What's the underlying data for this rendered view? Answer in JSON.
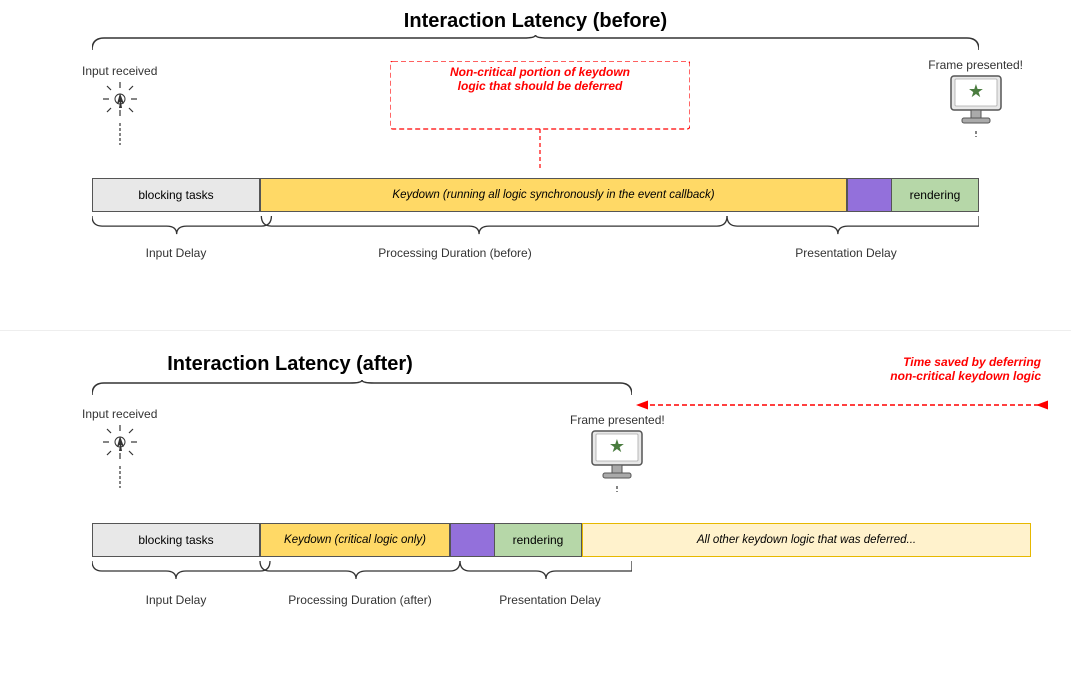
{
  "top": {
    "title": "Interaction Latency (before)",
    "input_received": "Input received",
    "frame_presented": "Frame presented!",
    "red_annotation_line1": "Non-critical portion of keydown",
    "red_annotation_line2": "logic that should be deferred",
    "blocking_tasks": "blocking tasks",
    "keydown_label": "Keydown (running all logic synchronously in the event callback)",
    "rendering": "rendering",
    "input_delay_label": "Input Delay",
    "processing_duration_label": "Processing Duration (before)",
    "presentation_delay_label": "Presentation Delay"
  },
  "bottom": {
    "title": "Interaction Latency (after)",
    "input_received": "Input received",
    "frame_presented": "Frame presented!",
    "red_time_saved_line1": "Time saved by deferring",
    "red_time_saved_line2": "non-critical keydown logic",
    "blocking_tasks": "blocking tasks",
    "keydown_label": "Keydown (critical logic only)",
    "rendering": "rendering",
    "deferred_label": "All other keydown logic that was deferred...",
    "input_delay_label": "Input Delay",
    "processing_duration_label": "Processing Duration (after)",
    "presentation_delay_label": "Presentation Delay"
  }
}
